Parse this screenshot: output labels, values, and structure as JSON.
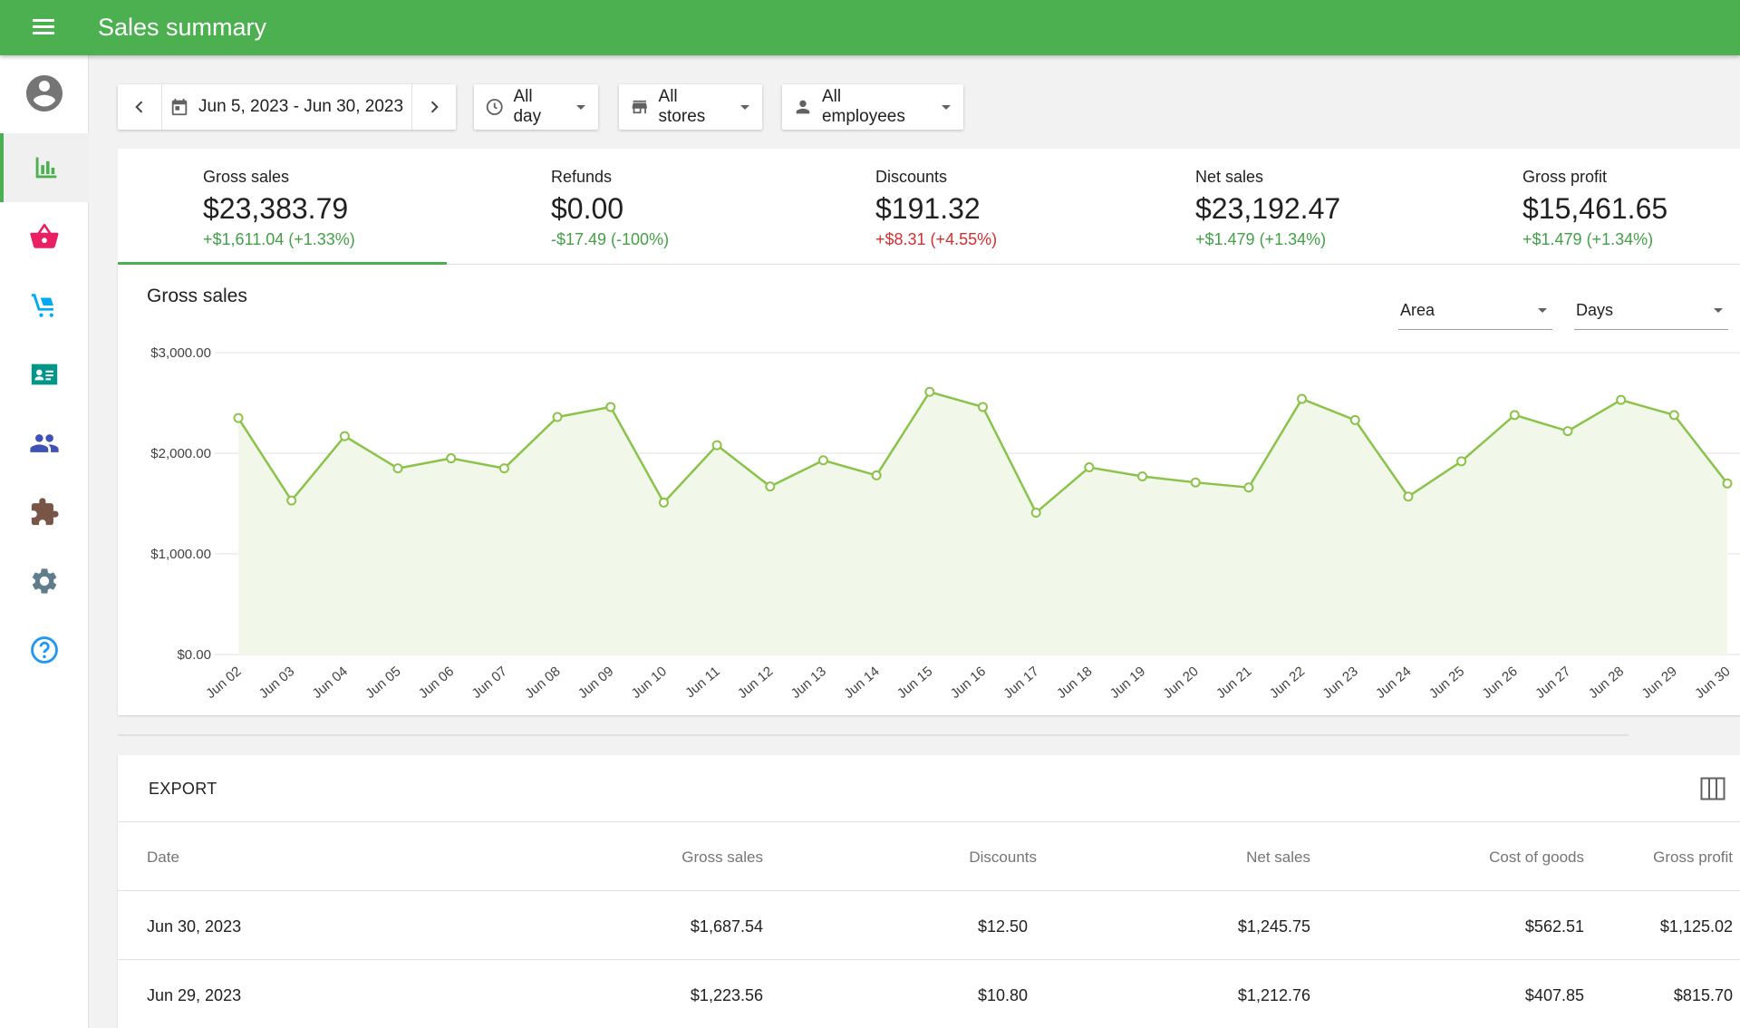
{
  "header": {
    "title": "Sales summary",
    "menu_icon": "menu-icon"
  },
  "sidebar": {
    "items": [
      {
        "name": "account",
        "icon": "account-circle-icon",
        "color": "#757575"
      },
      {
        "name": "reports",
        "icon": "bar-chart-icon",
        "color": "#4caf50",
        "active": true
      },
      {
        "name": "items",
        "icon": "basket-icon",
        "color": "#e91e63"
      },
      {
        "name": "inventory",
        "icon": "dolly-icon",
        "color": "#03a9f4"
      },
      {
        "name": "customers",
        "icon": "contact-card-icon",
        "color": "#009688"
      },
      {
        "name": "employees",
        "icon": "people-icon",
        "color": "#3f51b5"
      },
      {
        "name": "integrations",
        "icon": "puzzle-icon",
        "color": "#795548"
      },
      {
        "name": "settings",
        "icon": "gear-icon",
        "color": "#607d8b"
      },
      {
        "name": "help",
        "icon": "help-circle-icon",
        "color": "#2196f3"
      }
    ]
  },
  "filters": {
    "date_range": "Jun 5, 2023 - Jun 30, 2023",
    "time": "All day",
    "stores": "All stores",
    "employees": "All employees"
  },
  "kpis": [
    {
      "label": "Gross sales",
      "value": "$23,383.79",
      "delta": "+$1,611.04 (+1.33%)",
      "trend": "up"
    },
    {
      "label": "Refunds",
      "value": "$0.00",
      "delta": "-$17.49 (-100%)",
      "trend": "up"
    },
    {
      "label": "Discounts",
      "value": "$191.32",
      "delta": "+$8.31 (+4.55%)",
      "trend": "down"
    },
    {
      "label": "Net sales",
      "value": "$23,192.47",
      "delta": "+$1.479 (+1.34%)",
      "trend": "up"
    },
    {
      "label": "Gross profit",
      "value": "$15,461.65",
      "delta": "+$1.479 (+1.34%)",
      "trend": "up"
    }
  ],
  "colors": {
    "accent": "#4caf50",
    "positive": "#43a047",
    "negative": "#d32f2f",
    "line": "#8bc34a",
    "area": "#f1f8e9"
  },
  "chart": {
    "title": "Gross sales",
    "type_select": "Area",
    "period_select": "Days"
  },
  "chart_data": {
    "type": "area",
    "title": "Gross sales",
    "xlabel": "",
    "ylabel": "",
    "ylim": [
      0,
      3000
    ],
    "yticks": [
      "$0.00",
      "$1,000.00",
      "$2,000.00",
      "$3,000.00"
    ],
    "ytick_values": [
      0,
      1000,
      2000,
      3000
    ],
    "grid": true,
    "categories": [
      "Jun 02",
      "Jun 03",
      "Jun 04",
      "Jun 05",
      "Jun 06",
      "Jun 07",
      "Jun 08",
      "Jun 09",
      "Jun 10",
      "Jun 11",
      "Jun 12",
      "Jun 13",
      "Jun 14",
      "Jun 15",
      "Jun 16",
      "Jun 17",
      "Jun 18",
      "Jun 19",
      "Jun 20",
      "Jun 21",
      "Jun 22",
      "Jun 23",
      "Jun 24",
      "Jun 25",
      "Jun 26",
      "Jun 27",
      "Jun 28",
      "Jun 29",
      "Jun 30"
    ],
    "values": [
      2350,
      1530,
      2170,
      1850,
      1950,
      1850,
      2360,
      2460,
      1510,
      2080,
      1670,
      1930,
      1780,
      2610,
      2460,
      1410,
      1860,
      1770,
      1710,
      1660,
      2540,
      2330,
      1570,
      1920,
      2380,
      2220,
      2530,
      2380,
      1700
    ]
  },
  "table": {
    "export_label": "EXPORT",
    "columns_icon": "columns-icon",
    "headers": [
      "Date",
      "Gross sales",
      "Discounts",
      "Net sales",
      "Cost of goods",
      "Gross profit"
    ],
    "rows": [
      [
        "Jun 30, 2023",
        "$1,687.54",
        "$12.50",
        "$1,245.75",
        "$562.51",
        "$1,125.02"
      ],
      [
        "Jun 29, 2023",
        "$1,223.56",
        "$10.80",
        "$1,212.76",
        "$407.85",
        "$815.70"
      ]
    ]
  }
}
